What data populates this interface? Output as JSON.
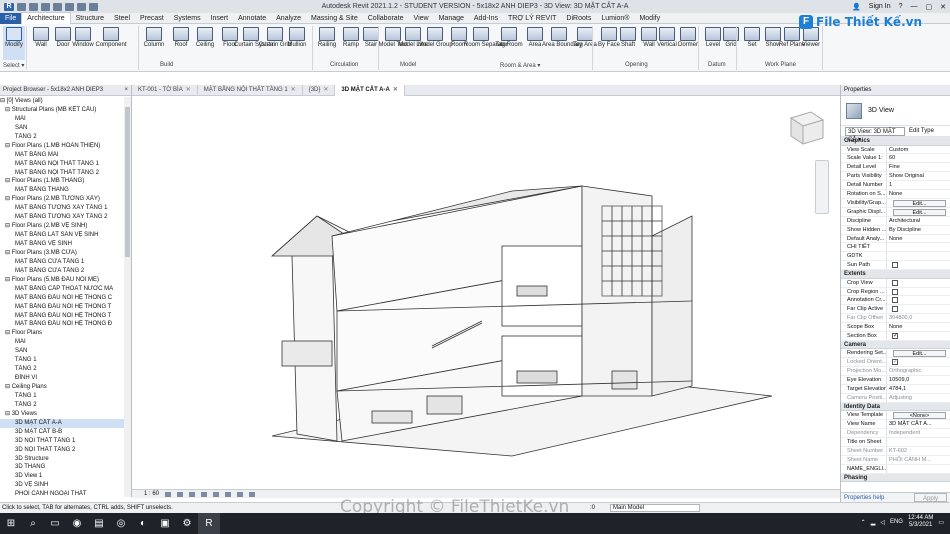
{
  "titlebar": {
    "title": "Autodesk Revit 2021.1.2 - STUDENT VERSION - 5x18x2 ANH DIEP3 - 3D View: 3D MẶT CẮT A-A",
    "sign_in": "Sign In",
    "help": "?"
  },
  "ribbon_tabs": [
    "File",
    "Architecture",
    "Structure",
    "Steel",
    "Precast",
    "Systems",
    "Insert",
    "Annotate",
    "Analyze",
    "Massing & Site",
    "Collaborate",
    "View",
    "Manage",
    "Add-Ins",
    "TRỢ LÝ REVIT",
    "DiRoots",
    "Lumion®",
    "Modify"
  ],
  "ribbon_tools": [
    "Modify",
    "Wall",
    "Door",
    "Window",
    "Component",
    "Column",
    "Roof",
    "Ceiling",
    "Floor",
    "Curtain System",
    "Curtain Grid",
    "Mullion",
    "Railing",
    "Ramp",
    "Stair",
    "Model Text",
    "Model Line",
    "Model Group",
    "Room",
    "Room Separator",
    "Tag Room",
    "Area",
    "Area Boundary",
    "Tag Area",
    "By Face",
    "Shaft",
    "Wall",
    "Vertical",
    "Dormer",
    "Level",
    "Grid",
    "Set",
    "Show",
    "Ref Plane",
    "Viewer"
  ],
  "ribbon_panels": [
    "Select ▾",
    "Build",
    "Circulation",
    "Model",
    "Room & Area ▾",
    "Opening",
    "Datum",
    "Work Plane"
  ],
  "logo": {
    "text": "File Thiết Kế.vn",
    "mark": "F"
  },
  "view_tabs": [
    {
      "label": "KT-001 - TỜ BÌA"
    },
    {
      "label": "MẶT BẰNG NỘI THẤT TẦNG 1"
    },
    {
      "label": "{3D}"
    },
    {
      "label": "3D MẶT CẮT A-A"
    }
  ],
  "project_browser": {
    "title": "Project Browser - 5x18x2 ANH DIEP3",
    "close": "×",
    "items": [
      "⊟ [0] Views (all)",
      "   ⊟ Structural Plans (MB KẾT CẤU)",
      "         MÁI",
      "         SÀN",
      "         TẦNG 2",
      "   ⊟ Floor Plans (1.MB HOÀN THIỆN)",
      "         MẶT BẰNG MÁI",
      "         MẶT BẰNG NỘI THẤT TẦNG 1",
      "         MẶT BẰNG NỘI THẤT TẦNG 2",
      "   ⊟ Floor Plans (1.MB THANG)",
      "         MẶT BẰNG THANG",
      "   ⊟ Floor Plans (2.MB TƯỜNG XÂY)",
      "         MẶT BẰNG TƯỜNG XÂY TẦNG 1",
      "         MẶT BẰNG TƯỜNG XÂY TẦNG 2",
      "   ⊟ Floor Plans (2.MB VỆ SINH)",
      "         MẶT BẰNG LÁT SÀN VỆ SINH",
      "         MẶT BẰNG VỆ SINH",
      "   ⊟ Floor Plans (3.MB CỬA)",
      "         MẶT BẰNG CỬA TẦNG 1",
      "         MẶT BẰNG CỬA TẦNG 2",
      "   ⊟ Floor Plans (5.MB ĐẦU NỐI ME)",
      "         MẶT BẰNG CẤP THOÁT NƯỚC MÁ",
      "         MẶT BẰNG ĐẦU NỐI HỆ THỐNG C",
      "         MẶT BẰNG ĐẦU NỐI HỆ THỐNG T",
      "         MẶT BẰNG ĐẦU NỐI HỆ THỐNG T",
      "         MẶT BẰNG ĐẦU NỐI HỆ THỐNG Đ",
      "   ⊟ Floor Plans",
      "         MÁI",
      "         SÀN",
      "         TẦNG 1",
      "         TẦNG 2",
      "         ĐỈNH VI",
      "   ⊟ Ceiling Plans",
      "         TẦNG 1",
      "         TẦNG 2",
      "   ⊟ 3D Views",
      "         3D MẶT CẮT A-A",
      "         3D MẶT CẮT B-B",
      "         3D NỘI THẤT TẦNG 1",
      "         3D NỘI THẤT TẦNG 2",
      "         3D Structure",
      "         3D THANG",
      "         3D View 1",
      "         3D VỆ SINH",
      "         PHỐI CẢNH NGOẠI THẤT"
    ],
    "selected_index": 36
  },
  "properties": {
    "title": "Properties",
    "type_name": "3D View",
    "selector": "3D View: 3D MẶT CẮ ▾",
    "edit_type": "Edit Type",
    "sections": [
      {
        "name": "Graphics",
        "rows": [
          {
            "k": "View Scale",
            "v": "Custom"
          },
          {
            "k": "Scale Value    1:",
            "v": "60"
          },
          {
            "k": "Detail Level",
            "v": "Fine"
          },
          {
            "k": "Parts Visibility",
            "v": "Show Original"
          },
          {
            "k": "Detail Number",
            "v": "1"
          },
          {
            "k": "Rotation on S...",
            "v": "None"
          },
          {
            "k": "Visibility/Grap...",
            "btn": "Edit..."
          },
          {
            "k": "Graphic Displ...",
            "btn": "Edit..."
          },
          {
            "k": "Discipline",
            "v": "Architectural"
          },
          {
            "k": "Show Hidden ...",
            "v": "By Discipline"
          },
          {
            "k": "Default Analy...",
            "v": "None"
          },
          {
            "k": "CHI TIẾT",
            "v": ""
          },
          {
            "k": "GDTK",
            "v": ""
          },
          {
            "k": "Sun Path",
            "cb": false
          }
        ]
      },
      {
        "name": "Extents",
        "rows": [
          {
            "k": "Crop View",
            "cb": false
          },
          {
            "k": "Crop Region ...",
            "cb": false
          },
          {
            "k": "Annotation Cr...",
            "cb": false
          },
          {
            "k": "Far Clip Active",
            "cb": false
          },
          {
            "k": "Far Clip Offset",
            "v": "304800,0",
            "dim": true
          },
          {
            "k": "Scope Box",
            "v": "None"
          },
          {
            "k": "Section Box",
            "cb": true
          }
        ]
      },
      {
        "name": "Camera",
        "rows": [
          {
            "k": "Rendering Set...",
            "btn": "Edit..."
          },
          {
            "k": "Locked Orient...",
            "cb": true,
            "dim": true
          },
          {
            "k": "Projection Mo...",
            "v": "Orthographic",
            "dim": true
          },
          {
            "k": "Eye Elevation",
            "v": "10509,0"
          },
          {
            "k": "Target Elevation",
            "v": "4784,1"
          },
          {
            "k": "Camera Positi...",
            "v": "Adjusting",
            "dim": true
          }
        ]
      },
      {
        "name": "Identity Data",
        "rows": [
          {
            "k": "View Template",
            "btn": "<None>"
          },
          {
            "k": "View Name",
            "v": "3D MẶT CẮT A..."
          },
          {
            "k": "Dependency",
            "v": "Independent",
            "dim": true
          },
          {
            "k": "Title on Sheet",
            "v": ""
          },
          {
            "k": "Sheet Number",
            "v": "KT-602",
            "dim": true
          },
          {
            "k": "Sheet Name",
            "v": "PHỐI CẢNH M...",
            "dim": true
          },
          {
            "k": "NAME_ENGLI...",
            "v": ""
          }
        ]
      },
      {
        "name": "Phasing",
        "rows": []
      }
    ],
    "help_link": "Properties help",
    "apply": "Apply"
  },
  "view_bar": {
    "scale": "1 : 60"
  },
  "status": {
    "message": "Click to select, TAB for alternates, CTRL adds, SHIFT unselects.",
    "active_model": "Main Model",
    "zero": ":0"
  },
  "watermark": "Copyright © FileThietKe.vn",
  "taskbar": {
    "time": "12:44 AM",
    "date": "5/3/2021",
    "lang": "ENG"
  }
}
